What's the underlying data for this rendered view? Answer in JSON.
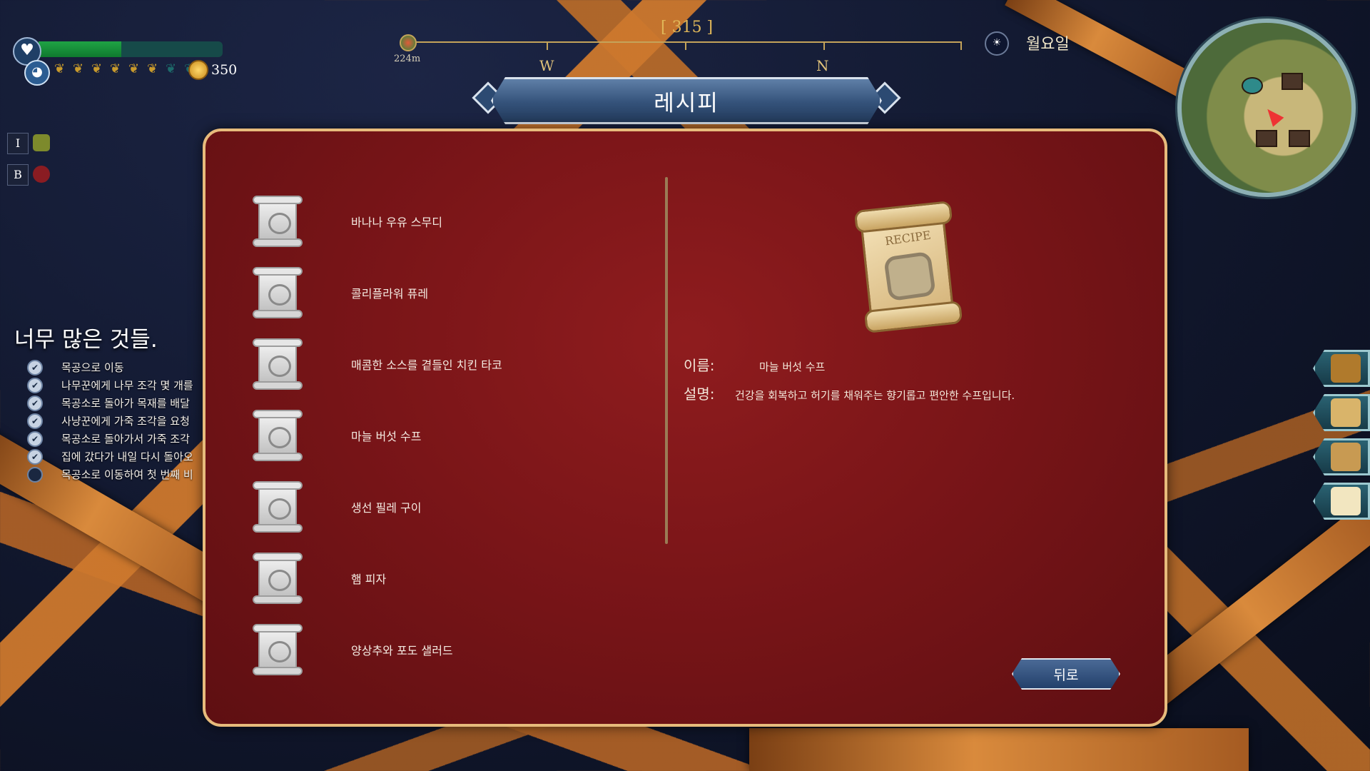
{
  "colors": {
    "panel": "#7a1518",
    "panel_border": "#e7bb7c",
    "banner": "#34527a",
    "compass_gold": "#c4a35a",
    "health": "#1fa345"
  },
  "hud": {
    "health_fraction": 0.45,
    "hunger_filled": 6,
    "hunger_total": 8,
    "coins": "350",
    "keys": [
      {
        "key": "I",
        "icon": "backpack-icon"
      },
      {
        "key": "B",
        "icon": "rose-icon"
      }
    ]
  },
  "compass": {
    "heading": "[ 315 ]",
    "distance": "224m",
    "dir_w": "W",
    "dir_n": "N"
  },
  "day": {
    "label": "월요일",
    "icon": "sunrise-icon"
  },
  "window": {
    "title": "레시피",
    "back_label": "뒤로"
  },
  "recipes": [
    {
      "name": "바나나 우유 스무디",
      "icon": "recipe-scroll-icon"
    },
    {
      "name": "콜리플라워 퓨레",
      "icon": "recipe-scroll-icon"
    },
    {
      "name": "매콤한 소스를 곁들인 치킨 타코",
      "icon": "recipe-scroll-icon"
    },
    {
      "name": "마늘 버섯 수프",
      "icon": "recipe-scroll-icon"
    },
    {
      "name": "생선 필레 구이",
      "icon": "recipe-scroll-icon"
    },
    {
      "name": "햄 피자",
      "icon": "recipe-scroll-icon"
    },
    {
      "name": "양상추와 포도 샐러드",
      "icon": "recipe-scroll-icon"
    }
  ],
  "detail": {
    "scroll_text": "RECIPE",
    "name_label": "이름:",
    "name_value": "마늘 버섯 수프",
    "desc_label": "설명:",
    "desc_value": "건강을 회복하고 허기를 채워주는 향기롭고 편안한 수프입니다."
  },
  "quest": {
    "title": "너무 많은 것들.",
    "items": [
      {
        "text": "목공으로 이동",
        "done": true
      },
      {
        "text": "나무꾼에게 나무 조각 몇 개를",
        "done": true
      },
      {
        "text": "목공소로 돌아가 목재를 배달",
        "done": true
      },
      {
        "text": "사냥꾼에게 가죽 조각을 요청",
        "done": true
      },
      {
        "text": "목공소로 돌아가서 가죽 조각",
        "done": true
      },
      {
        "text": "집에 갔다가 내일 다시 돌아오",
        "done": true
      },
      {
        "text": "목공소로 이동하여 첫 번째 비",
        "done": false
      }
    ]
  },
  "side_tabs": [
    {
      "icon": "backpack-tab-icon"
    },
    {
      "icon": "scroll-tab-icon"
    },
    {
      "icon": "book-tab-icon"
    },
    {
      "icon": "fried-egg-tab-icon"
    }
  ]
}
